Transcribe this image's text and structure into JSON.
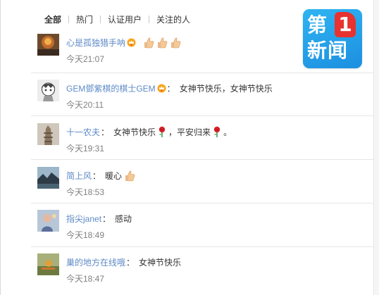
{
  "tabs": [
    {
      "label": "全部",
      "active": true
    },
    {
      "label": "热门",
      "active": false
    },
    {
      "label": "认证用户",
      "active": false
    },
    {
      "label": "关注的人",
      "active": false
    }
  ],
  "logo": {
    "line1": "第",
    "num": "1",
    "line2": "新闻"
  },
  "comments": [
    {
      "user": "心是孤独猎手呐",
      "colon": "",
      "segments": [],
      "emoji_after": [
        "thumbs-up-icon",
        "thumbs-up-icon",
        "thumbs-up-icon"
      ],
      "time": "今天21:07",
      "crown": true
    },
    {
      "user": "GEM鄧紫棋的棋士GEM",
      "colon": "：",
      "text": "女神节快乐，女神节快乐",
      "time": "今天20:11",
      "crown": true
    },
    {
      "user": "十一农夫",
      "colon": "：",
      "text_a": "女神节快乐",
      "text_b": "，平安归来",
      "text_c": "。",
      "time": "今天19:31"
    },
    {
      "user": "简上风",
      "colon": "：",
      "text": "暖心",
      "time": "今天18:53"
    },
    {
      "user": "指尖janet",
      "colon": "：",
      "text": "感动",
      "time": "今天18:49"
    },
    {
      "user": "巢的地方在线哦",
      "colon": "：",
      "text": "女神节快乐",
      "time": "今天18:47"
    }
  ],
  "colors": {
    "link": "#5e8ac7",
    "time": "#808080",
    "brand": "#1d8fe0",
    "accent": "#e8322f"
  }
}
